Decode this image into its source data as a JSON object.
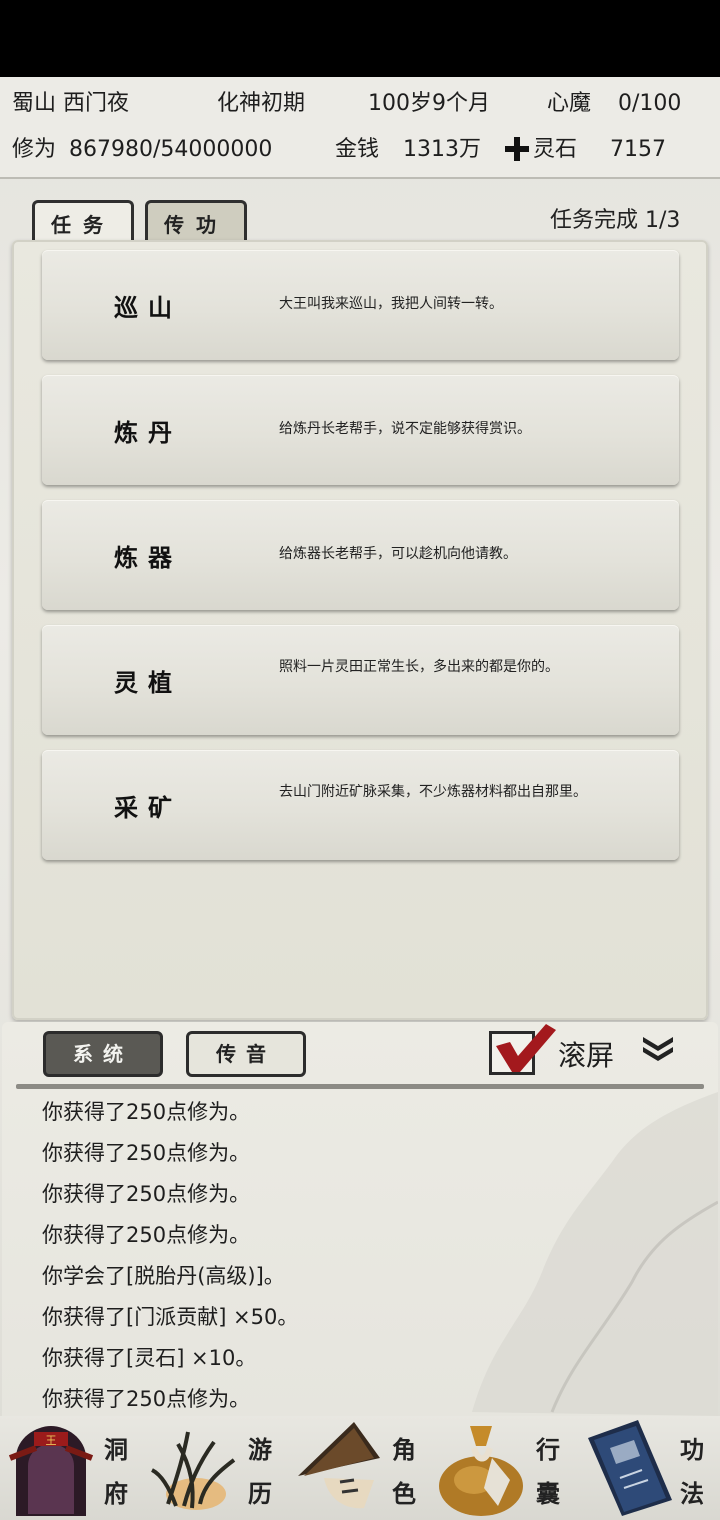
{
  "status": {
    "location": "蜀山 西门夜",
    "realm": "化神初期",
    "age": "100岁9个月",
    "demon_label": "心魔",
    "demon_value": "0/100",
    "cultivation_label": "修为",
    "cultivation_value": "867980/54000000",
    "money_label": "金钱",
    "money_value": "1313万",
    "stone_label": "灵石",
    "stone_value": "7157"
  },
  "tabs": {
    "tasks": "任务",
    "transmit": "传功"
  },
  "task_progress": "任务完成  1/3",
  "tasks": [
    {
      "title": "巡山",
      "desc": "大王叫我来巡山，我把人间转一转。"
    },
    {
      "title": "炼丹",
      "desc": "给炼丹长老帮手，说不定能够获得赏识。"
    },
    {
      "title": "炼器",
      "desc": "给炼器长老帮手，可以趁机向他请教。"
    },
    {
      "title": "灵植",
      "desc": "照料一片灵田正常生长，多出来的都是你的。"
    },
    {
      "title": "采矿",
      "desc": "去山门附近矿脉采集，不少炼器材料都出自那里。"
    }
  ],
  "log": {
    "system_tab": "系统",
    "message_tab": "传音",
    "scroll_label": "滚屏",
    "lines": [
      "你获得了250点修为。",
      "你获得了250点修为。",
      "你获得了250点修为。",
      "你获得了250点修为。",
      "你学会了[脱胎丹(高级)]。",
      "你获得了[门派贡献] ×50。",
      "你获得了[灵石] ×10。",
      "你获得了250点修为。"
    ]
  },
  "nav": [
    {
      "top": "洞",
      "bottom": "府",
      "icon": "cave-palace-icon"
    },
    {
      "top": "游",
      "bottom": "历",
      "icon": "travel-grass-icon"
    },
    {
      "top": "角",
      "bottom": "色",
      "icon": "character-hat-icon"
    },
    {
      "top": "行",
      "bottom": "囊",
      "icon": "bag-icon"
    },
    {
      "top": "功",
      "bottom": "法",
      "icon": "scroll-book-icon"
    }
  ],
  "colors": {
    "background": "#e6e5df",
    "panel": "#e6e5dc",
    "accent_red": "#a3191d",
    "text": "#222222"
  }
}
